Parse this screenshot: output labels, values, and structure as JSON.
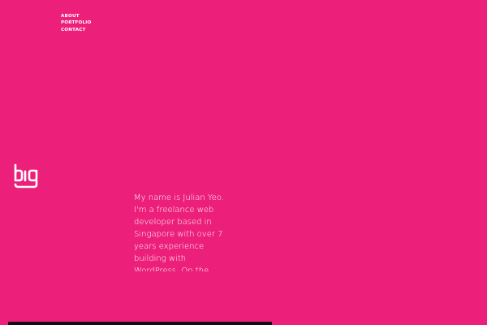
{
  "nav": {
    "items": [
      {
        "label": "ABOUT"
      },
      {
        "label": "PORTFOLIO"
      },
      {
        "label": "CONTACT"
      }
    ]
  },
  "logo": {
    "icon": "biq-logo-icon"
  },
  "intro": {
    "text": "My name is Julian Yeo. I'm a freelance web developer based in Singapore with over 7 years experience building with WordPress. On the side, I run and"
  },
  "colors": {
    "background": "#ec1f7a",
    "text": "#ffffff",
    "strip": "#160a16"
  }
}
